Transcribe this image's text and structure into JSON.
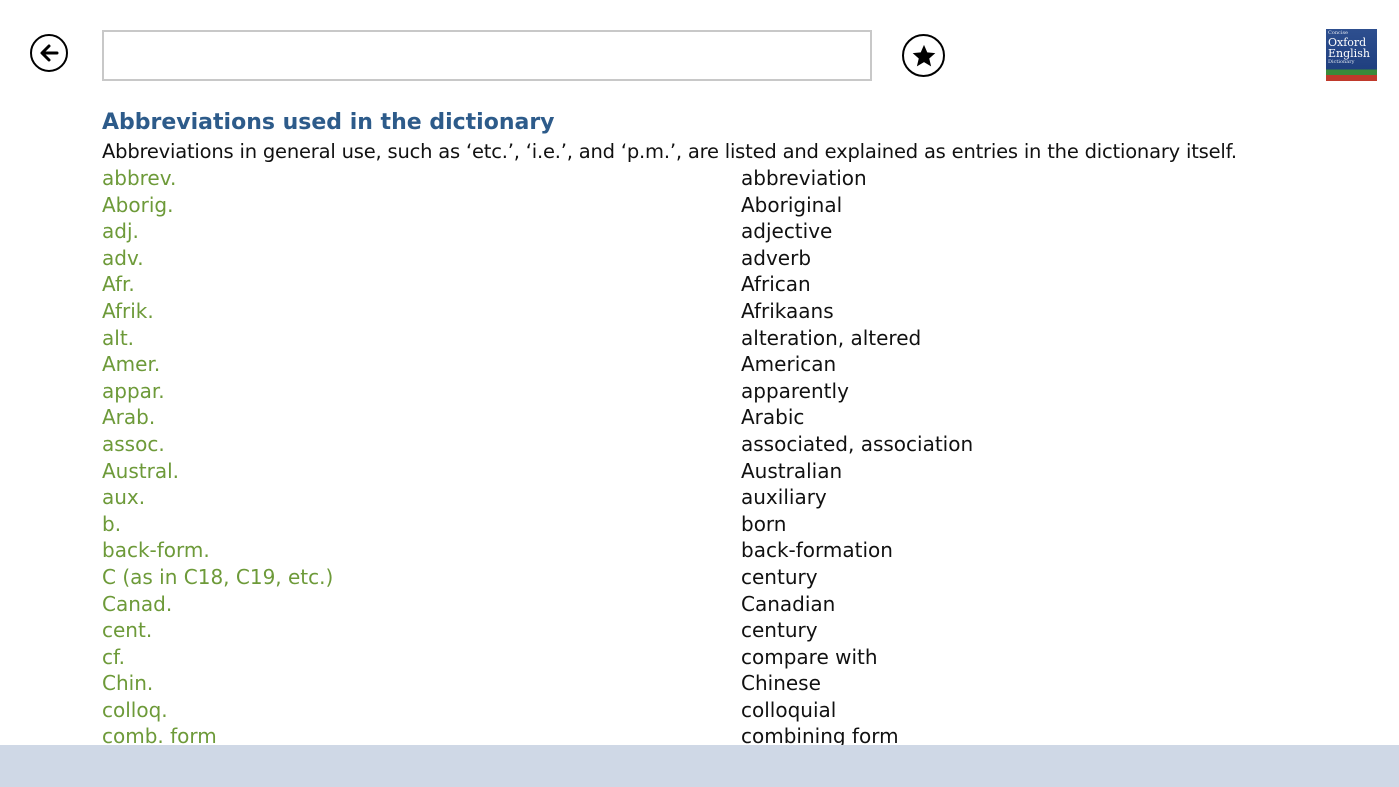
{
  "header": {
    "search": {
      "value": "",
      "placeholder": ""
    },
    "logo": {
      "line1": "Concise",
      "line2": "Oxford",
      "line3": "English",
      "line4": "Dictionary"
    }
  },
  "main": {
    "title": "Abbreviations used in the dictionary",
    "intro": "Abbreviations in general use, such as ‘etc.’, ‘i.e.’, and ‘p.m.’, are listed and explained as entries in the dictionary itself.",
    "entries": [
      {
        "abbr": "abbrev.",
        "meaning": "abbreviation"
      },
      {
        "abbr": "Aborig.",
        "meaning": "Aboriginal"
      },
      {
        "abbr": "adj.",
        "meaning": "adjective"
      },
      {
        "abbr": "adv.",
        "meaning": "adverb"
      },
      {
        "abbr": "Afr.",
        "meaning": "African"
      },
      {
        "abbr": "Afrik.",
        "meaning": "Afrikaans"
      },
      {
        "abbr": "alt.",
        "meaning": "alteration, altered"
      },
      {
        "abbr": "Amer.",
        "meaning": "American"
      },
      {
        "abbr": "appar.",
        "meaning": "apparently"
      },
      {
        "abbr": "Arab.",
        "meaning": "Arabic"
      },
      {
        "abbr": "assoc.",
        "meaning": "associated, association"
      },
      {
        "abbr": "Austral.",
        "meaning": "Australian"
      },
      {
        "abbr": "aux.",
        "meaning": "auxiliary"
      },
      {
        "abbr": "b.",
        "meaning": "born"
      },
      {
        "abbr": "back-form.",
        "meaning": "back-formation"
      },
      {
        "abbr": "C (as in C18, C19, etc.)",
        "meaning": "century"
      },
      {
        "abbr": "Canad.",
        "meaning": "Canadian"
      },
      {
        "abbr": "cent.",
        "meaning": "century"
      },
      {
        "abbr": "cf.",
        "meaning": "compare with"
      },
      {
        "abbr": "Chin.",
        "meaning": "Chinese"
      },
      {
        "abbr": "colloq.",
        "meaning": "colloquial"
      },
      {
        "abbr": "comb. form",
        "meaning": "combining form"
      }
    ]
  },
  "colors": {
    "title": "#2d5b8a",
    "abbreviation": "#6d9a39",
    "bottom_bar": "#cfd8e6"
  }
}
